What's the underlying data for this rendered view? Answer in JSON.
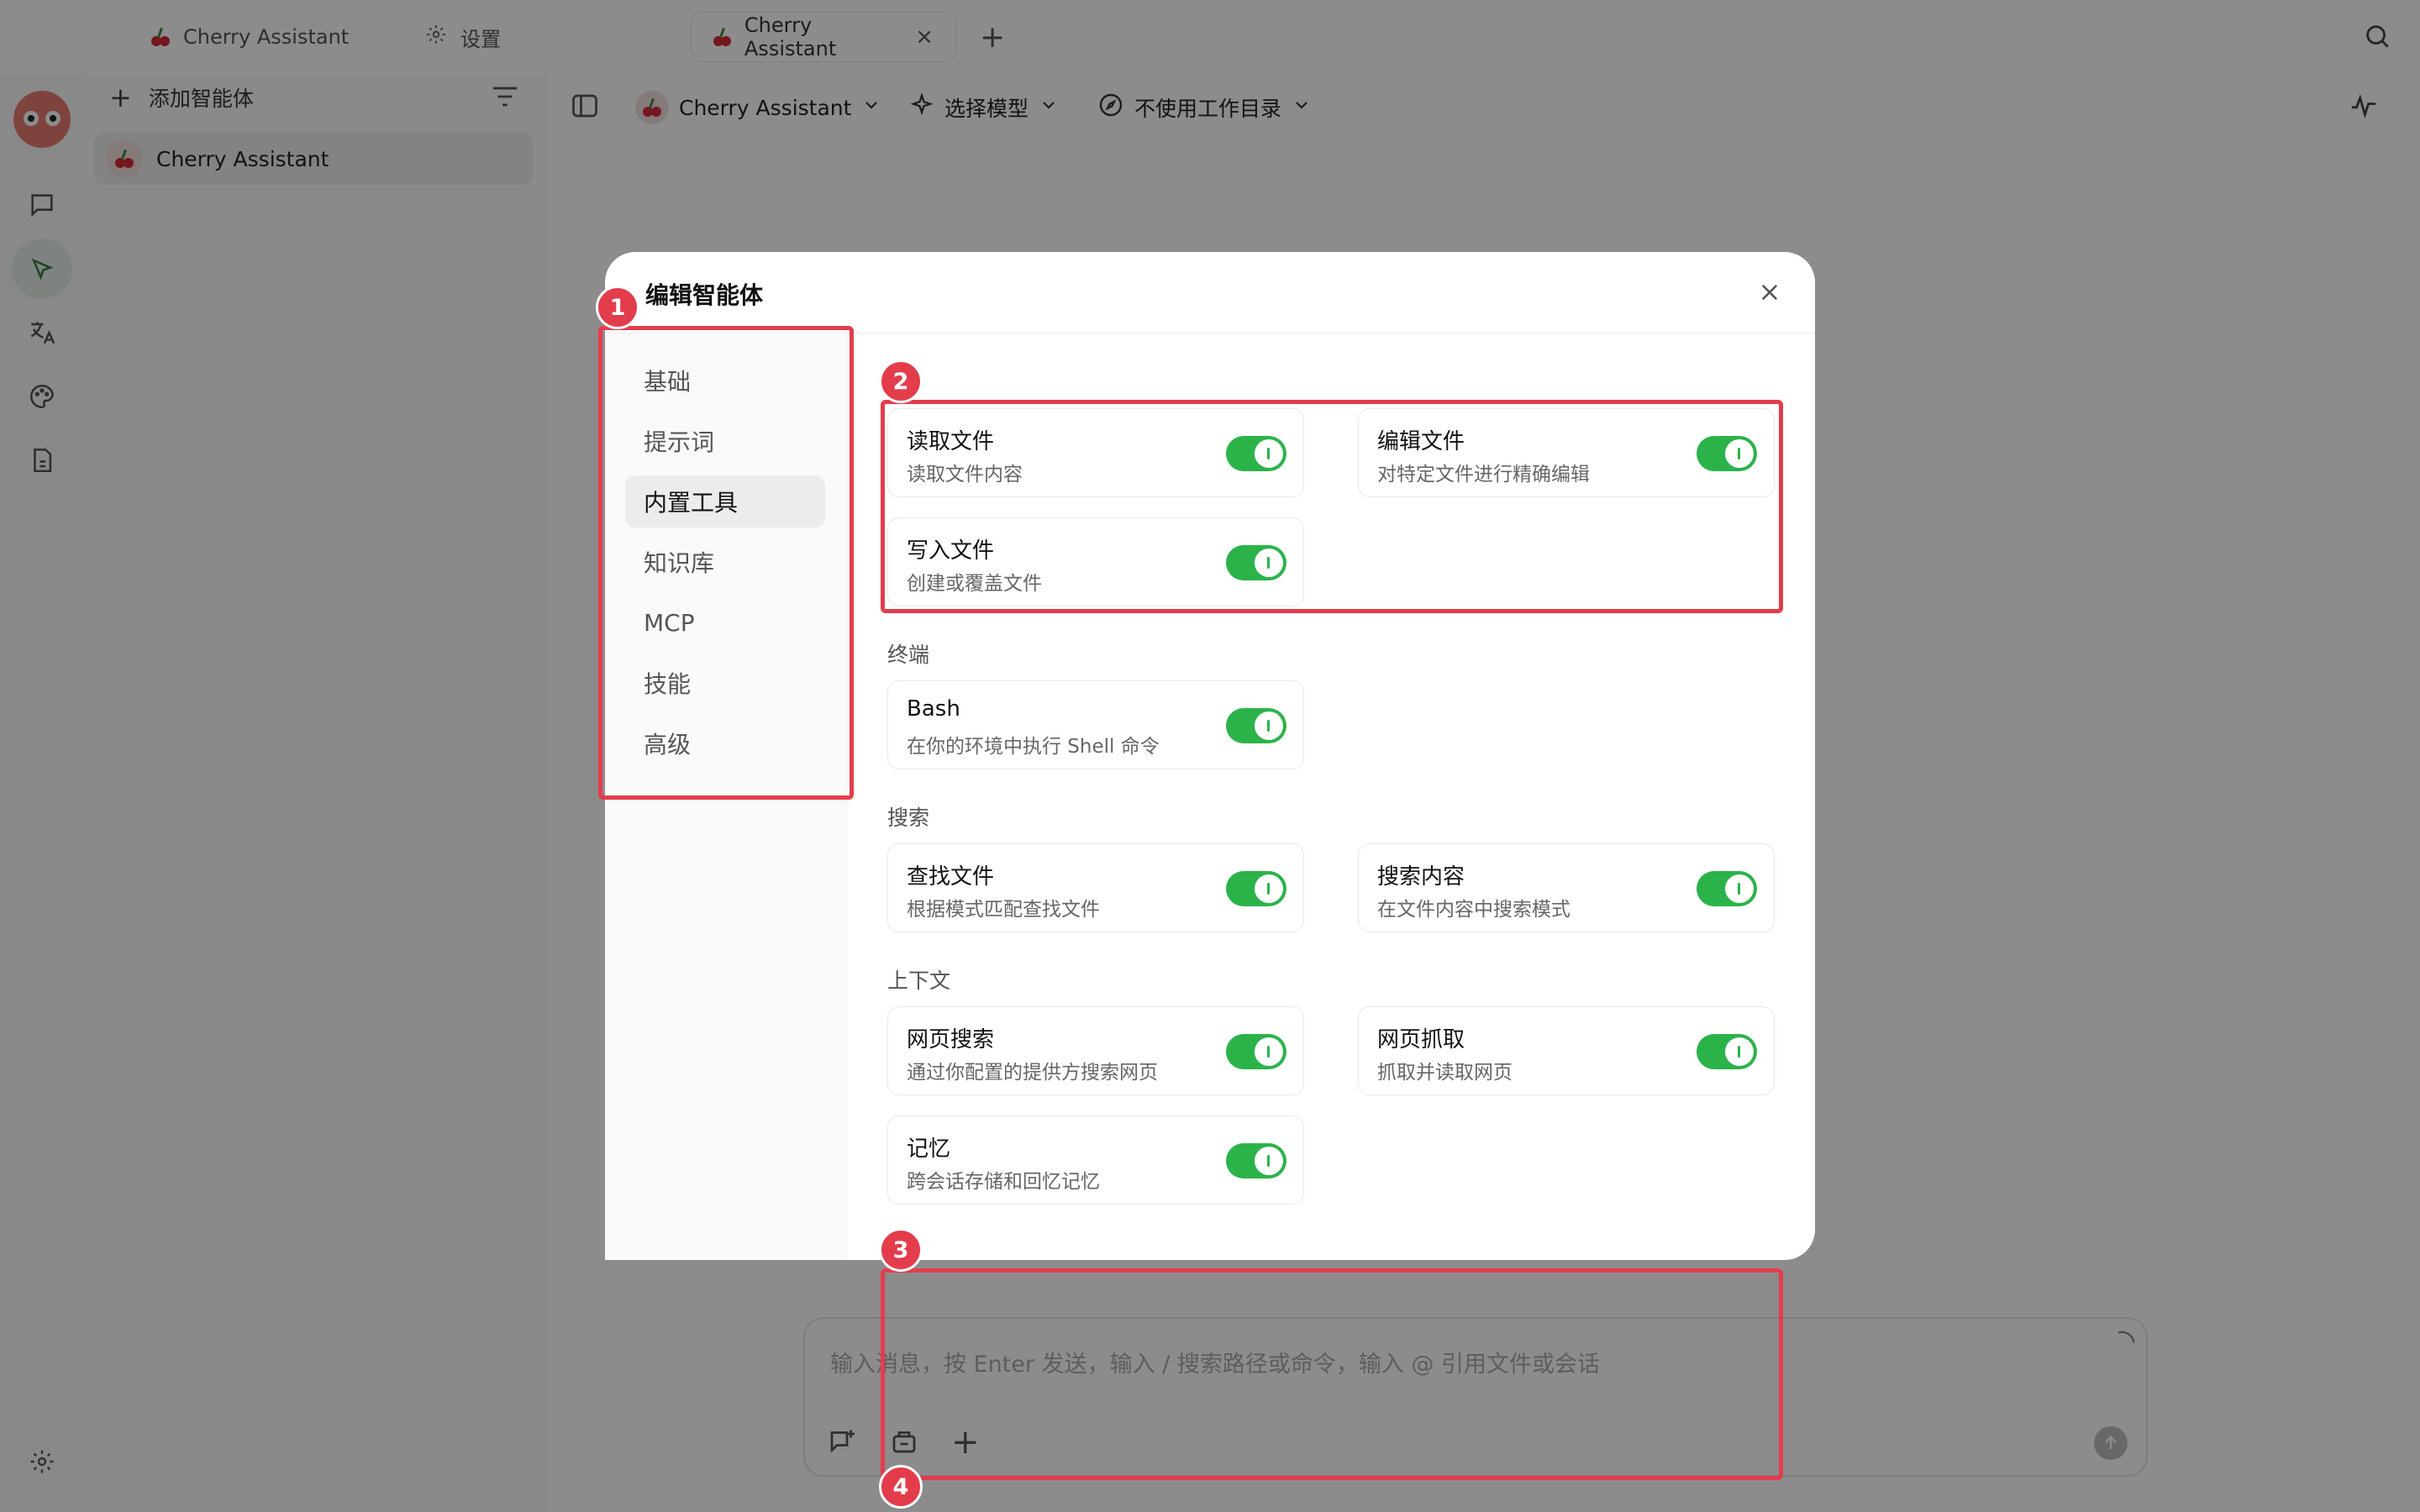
{
  "tabs": [
    {
      "label": "Cherry Assistant",
      "icon": "cherry-icon"
    },
    {
      "label": "设置",
      "icon": "gear-icon"
    },
    {
      "label": "Cherry Assistant",
      "icon": "cherry-icon",
      "active": true,
      "close": "×"
    }
  ],
  "sidebar": {
    "add_label": "添加智能体",
    "items": [
      {
        "label": "Cherry Assistant"
      }
    ]
  },
  "toolbar": {
    "agent": "Cherry Assistant",
    "model": "选择模型",
    "workdir": "不使用工作目录"
  },
  "composer": {
    "placeholder": "输入消息，按 Enter 发送，输入 / 搜索路径或命令，输入 @ 引用文件或会话"
  },
  "modal": {
    "title": "编辑智能体",
    "nav": [
      "基础",
      "提示词",
      "内置工具",
      "知识库",
      "MCP",
      "技能",
      "高级"
    ],
    "active_nav": "内置工具",
    "file_section_suffix": ":",
    "sections": {
      "terminal": "终端",
      "search": "搜索",
      "context": "上下文"
    },
    "tools": {
      "read": {
        "name": "读取文件",
        "desc": "读取文件内容",
        "enabled": true
      },
      "edit": {
        "name": "编辑文件",
        "desc": "对特定文件进行精确编辑",
        "enabled": true
      },
      "write": {
        "name": "写入文件",
        "desc": "创建或覆盖文件",
        "enabled": true
      },
      "bash": {
        "name": "Bash",
        "desc": "在你的环境中执行 Shell 命令",
        "enabled": true
      },
      "find": {
        "name": "查找文件",
        "desc": "根据模式匹配查找文件",
        "enabled": true
      },
      "grep": {
        "name": "搜索内容",
        "desc": "在文件内容中搜索模式",
        "enabled": true
      },
      "websearch": {
        "name": "网页搜索",
        "desc": "通过你配置的提供方搜索网页",
        "enabled": true
      },
      "webfetch": {
        "name": "网页抓取",
        "desc": "抓取并读取网页",
        "enabled": true
      },
      "memory": {
        "name": "记忆",
        "desc": "跨会话存储和回忆记忆",
        "enabled": true
      }
    }
  },
  "annotations": [
    "1",
    "2",
    "3",
    "4"
  ],
  "colors": {
    "toggle_on": "#2bb34a",
    "annotation": "#e33d4c"
  }
}
